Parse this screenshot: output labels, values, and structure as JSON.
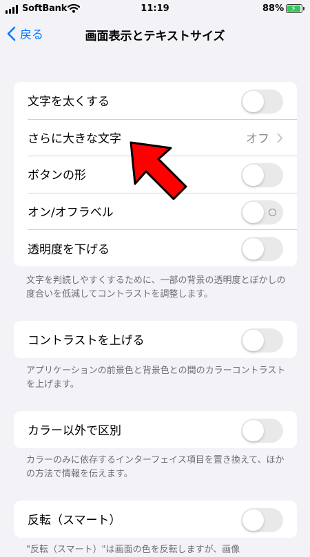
{
  "status_bar": {
    "carrier": "SoftBank",
    "time": "11:19",
    "battery": "88%",
    "battery_level": 0.88
  },
  "nav": {
    "back_label": "戻る",
    "title": "画面表示とテキストサイズ"
  },
  "group1": {
    "rows": [
      {
        "label": "文字を太くする",
        "control": "toggle",
        "on": false
      },
      {
        "label": "さらに大きな文字",
        "control": "disclosure",
        "value": "オフ"
      },
      {
        "label": "ボタンの形",
        "control": "toggle",
        "on": false
      },
      {
        "label": "オン/オフラベル",
        "control": "toggle",
        "on": false
      },
      {
        "label": "透明度を下げる",
        "control": "toggle",
        "on": false
      }
    ],
    "footer": "文字を判読しやすくするために、一部の背景の透明度とぼかしの度合いを低減してコントラストを調整します。"
  },
  "group2": {
    "label": "コントラストを上げる",
    "footer": "アプリケーションの前景色と背景色との間のカラーコントラストを上げます。"
  },
  "group3": {
    "label": "カラー以外で区別",
    "footer": "カラーのみに依存するインターフェイス項目を置き換えて、ほかの方法で情報を伝えます。"
  },
  "group4": {
    "label": "反転（スマート）",
    "footer": "\"反転（スマート）\"は画面の色を反転しますが、画像"
  },
  "colors": {
    "accent": "#007aff",
    "background": "#f2f2f7",
    "toggle_off": "#e9e9ea",
    "annotation_arrow": "#ff0000"
  },
  "icons": {
    "back": "chevron-left-icon",
    "disclosure": "chevron-right-icon",
    "signal": "cell-signal-icon",
    "wifi": "wifi-icon",
    "battery": "battery-charging-icon"
  }
}
